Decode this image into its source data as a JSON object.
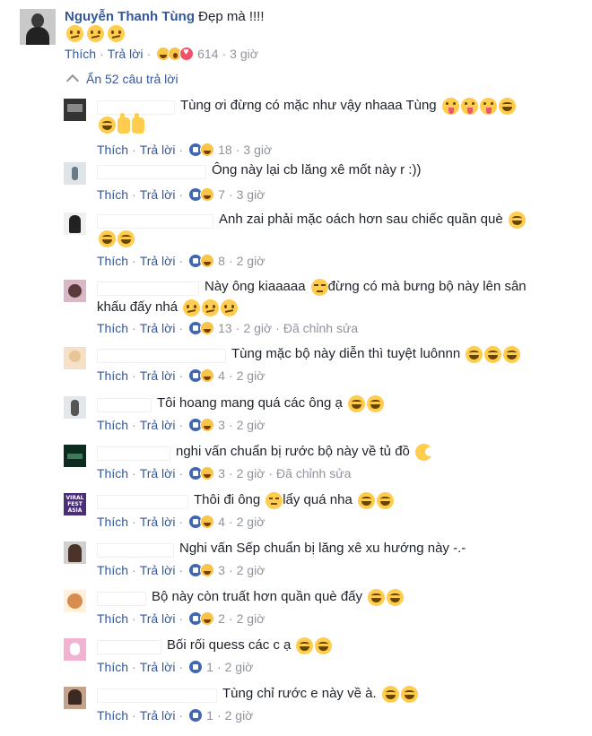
{
  "top_comment": {
    "author": "Nguyễn Thanh Tùng",
    "text": " Đẹp mà !!!!",
    "emojis": [
      "confused-face",
      "confused-face",
      "confused-face"
    ],
    "actions": {
      "like": "Thích",
      "reply": "Trả lời"
    },
    "reactions": [
      "haha",
      "wow",
      "love"
    ],
    "reaction_count": "614",
    "time": "3 giờ"
  },
  "hide_replies_label": "Ẩn 52 câu trả lời",
  "replies": [
    {
      "text": "Tùng ơi đừng có mặc như vậy nhaaa Tùng",
      "emojis": [
        "tongue",
        "tongue",
        "tongue",
        "laugh"
      ],
      "text2": "",
      "emojis2": [
        "laugh",
        "thumb",
        "thumb"
      ],
      "reactions": [
        "like",
        "haha"
      ],
      "count": "18",
      "time": "3 giờ",
      "edited": ""
    },
    {
      "text": "Ông này lại cb lăng xê mốt này r :))",
      "emojis": [],
      "text2": "",
      "emojis2": [],
      "reactions": [
        "like",
        "haha"
      ],
      "count": "7",
      "time": "3 giờ",
      "edited": ""
    },
    {
      "text": "Anh zai phải mặc oách hơn sau chiếc quần què",
      "emojis": [
        "laugh"
      ],
      "text2": "",
      "emojis2": [
        "laugh",
        "laugh"
      ],
      "reactions": [
        "like",
        "haha"
      ],
      "count": "8",
      "time": "2 giờ",
      "edited": ""
    },
    {
      "text": "Này ông kiaaaaa",
      "emojis": [
        "unamused"
      ],
      "text_after": " đừng có mà bưng bộ này lên sân",
      "text2": "khấu đấy nhá",
      "emojis2": [
        "confused",
        "confused",
        "confused"
      ],
      "reactions": [
        "like",
        "haha"
      ],
      "count": "13",
      "time": "2 giờ",
      "edited": "Đã chỉnh sửa"
    },
    {
      "text": "Tùng mặc bộ này diễn thì tuyệt luônnn",
      "emojis": [
        "laugh",
        "laugh",
        "laugh"
      ],
      "text2": "",
      "emojis2": [],
      "reactions": [
        "like",
        "haha"
      ],
      "count": "4",
      "time": "2 giờ",
      "edited": ""
    },
    {
      "text": "Tôi hoang mang quá các ông ạ",
      "emojis": [
        "laugh",
        "laugh"
      ],
      "text2": "",
      "emojis2": [],
      "reactions": [
        "like",
        "haha"
      ],
      "count": "3",
      "time": "2 giờ",
      "edited": ""
    },
    {
      "text": "nghi vấn chuẩn bị rước bộ này về tủ đồ",
      "emojis": [
        "moon"
      ],
      "text2": "",
      "emojis2": [],
      "reactions": [
        "like",
        "haha"
      ],
      "count": "3",
      "time": "2 giờ",
      "edited": "Đã chỉnh sửa"
    },
    {
      "text": "Thôi đi ông",
      "emojis": [
        "sweat"
      ],
      "text_after": " lẩy quá nha",
      "emojis_after": [
        "laugh",
        "laugh"
      ],
      "text2": "",
      "emojis2": [],
      "reactions": [
        "like",
        "haha"
      ],
      "count": "4",
      "time": "2 giờ",
      "edited": ""
    },
    {
      "text": "Nghi vấn Sếp chuẩn bị lăng xê xu hướng này -.-",
      "emojis": [],
      "text2": "",
      "emojis2": [],
      "reactions": [
        "like",
        "haha"
      ],
      "count": "3",
      "time": "2 giờ",
      "edited": ""
    },
    {
      "text": "Bộ này còn truất hơn quần què đấy",
      "emojis": [
        "laugh",
        "laugh"
      ],
      "text2": "",
      "emojis2": [],
      "reactions": [
        "like",
        "haha"
      ],
      "count": "2",
      "time": "2 giờ",
      "edited": ""
    },
    {
      "text": "Bối rối quess các c ạ",
      "emojis": [
        "laugh",
        "laugh"
      ],
      "text2": "",
      "emojis2": [],
      "reactions": [
        "like"
      ],
      "count": "1",
      "time": "2 giờ",
      "edited": ""
    },
    {
      "text": "Tùng chỉ rước e này về à.",
      "emojis": [
        "laugh",
        "laugh"
      ],
      "text2": "",
      "emojis2": [],
      "reactions": [
        "like"
      ],
      "count": "1",
      "time": "2 giờ",
      "edited": ""
    }
  ],
  "avatar_text_viral": [
    "VIRAL",
    "FEST",
    "ASIA"
  ],
  "colors": {
    "link": "#365899",
    "meta_gray": "#90949c",
    "text": "#1d2129",
    "like_blue": "#4267b2",
    "emoji_yellow": "#ffcc4d"
  }
}
